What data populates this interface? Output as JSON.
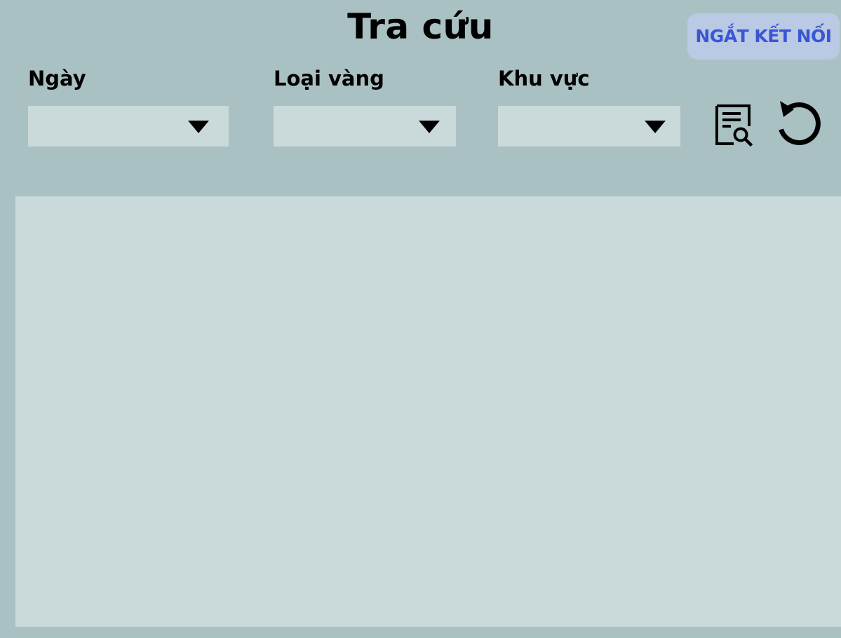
{
  "header": {
    "title": "Tra cứu",
    "disconnect_label": "NGẮT KẾT NỐI"
  },
  "filters": {
    "date": {
      "label": "Ngày",
      "value": ""
    },
    "gold_type": {
      "label": "Loại vàng",
      "value": ""
    },
    "region": {
      "label": "Khu vực",
      "value": ""
    }
  },
  "actions": {
    "search_icon": "document-search-icon",
    "reset_icon": "refresh-icon"
  },
  "results": {
    "rows": []
  },
  "colors": {
    "background": "#a9c1c2",
    "panel": "#cad9d9",
    "button_bg": "#bac9e4",
    "button_text": "#3a56d4"
  }
}
